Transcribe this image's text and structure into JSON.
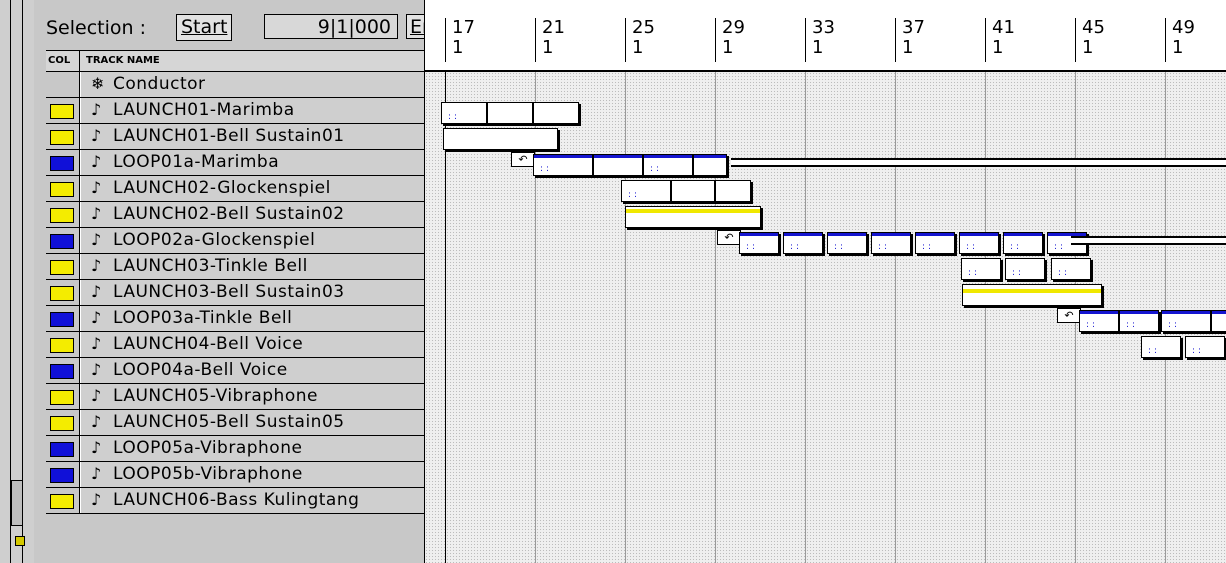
{
  "selection": {
    "label": "Selection :",
    "start_button": "Start",
    "value": "9|1|000",
    "end_button": "Er"
  },
  "header": {
    "col": "COL",
    "track_name": "TRACK NAME"
  },
  "tracks": [
    {
      "name": "Conductor",
      "color": "",
      "icon": "conductor-icon"
    },
    {
      "name": "LAUNCH01-Marimba",
      "color": "#f4ec00",
      "icon": "midi-note-icon"
    },
    {
      "name": "LAUNCH01-Bell Sustain01",
      "color": "#f4ec00",
      "icon": "midi-note-icon"
    },
    {
      "name": "LOOP01a-Marimba",
      "color": "#1010d8",
      "icon": "midi-note-icon"
    },
    {
      "name": "LAUNCH02-Glockenspiel",
      "color": "#f4ec00",
      "icon": "midi-note-icon"
    },
    {
      "name": "LAUNCH02-Bell Sustain02",
      "color": "#f4ec00",
      "icon": "midi-note-icon"
    },
    {
      "name": "LOOP02a-Glockenspiel",
      "color": "#1010d8",
      "icon": "midi-note-icon"
    },
    {
      "name": "LAUNCH03-Tinkle Bell",
      "color": "#f4ec00",
      "icon": "midi-note-icon"
    },
    {
      "name": "LAUNCH03-Bell Sustain03",
      "color": "#f4ec00",
      "icon": "midi-note-icon"
    },
    {
      "name": "LOOP03a-Tinkle Bell",
      "color": "#1010d8",
      "icon": "midi-note-icon"
    },
    {
      "name": "LAUNCH04-Bell Voice",
      "color": "#f4ec00",
      "icon": "midi-note-icon"
    },
    {
      "name": "LOOP04a-Bell Voice",
      "color": "#1010d8",
      "icon": "midi-note-icon"
    },
    {
      "name": "LAUNCH05-Vibraphone",
      "color": "#f4ec00",
      "icon": "midi-note-icon"
    },
    {
      "name": "LAUNCH05-Bell Sustain05",
      "color": "#f4ec00",
      "icon": "midi-note-icon"
    },
    {
      "name": "LOOP05a-Vibraphone",
      "color": "#1010d8",
      "icon": "midi-note-icon"
    },
    {
      "name": "LOOP05b-Vibraphone",
      "color": "#1010d8",
      "icon": "midi-note-icon"
    },
    {
      "name": "LAUNCH06-Bass Kulingtang",
      "color": "#f4ec00",
      "icon": "midi-note-icon"
    }
  ],
  "ruler": [
    {
      "bar": "17",
      "beat": "1"
    },
    {
      "bar": "21",
      "beat": "1"
    },
    {
      "bar": "25",
      "beat": "1"
    },
    {
      "bar": "29",
      "beat": "1"
    },
    {
      "bar": "33",
      "beat": "1"
    },
    {
      "bar": "37",
      "beat": "1"
    },
    {
      "bar": "41",
      "beat": "1"
    },
    {
      "bar": "45",
      "beat": "1"
    },
    {
      "bar": "49",
      "beat": "1"
    }
  ],
  "colors": {
    "yellow": "#f4ec00",
    "blue": "#1010d8",
    "panel": "#c8c8c8"
  },
  "icons": {
    "conductor": "❄",
    "note": "♪",
    "loop": "↶"
  }
}
